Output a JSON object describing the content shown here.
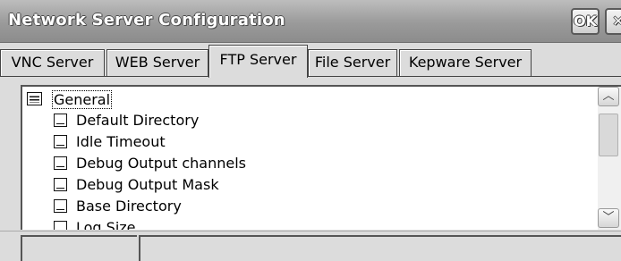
{
  "window": {
    "title": "Network Server Configuration",
    "ok_label": "OK",
    "close_label": "✕"
  },
  "tabs": [
    {
      "label": "VNC Server",
      "active": false
    },
    {
      "label": "WEB Server",
      "active": false
    },
    {
      "label": "FTP Server",
      "active": true
    },
    {
      "label": "File Server",
      "active": false
    },
    {
      "label": "Kepware Server",
      "active": false
    }
  ],
  "tree": {
    "root_label": "General",
    "items": [
      {
        "label": "Default Directory",
        "icon": "property-icon"
      },
      {
        "label": "Idle Timeout",
        "icon": "property-icon"
      },
      {
        "label": "Debug Output channels",
        "icon": "property-icon"
      },
      {
        "label": "Debug Output Mask",
        "icon": "property-icon"
      },
      {
        "label": "Base Directory",
        "icon": "property-icon"
      },
      {
        "label": "Log Size",
        "icon": "property-icon"
      }
    ]
  },
  "scrollbar": {
    "up_glyph": "︿",
    "down_glyph": "﹀"
  },
  "status": {
    "cells": [
      "",
      ""
    ]
  }
}
